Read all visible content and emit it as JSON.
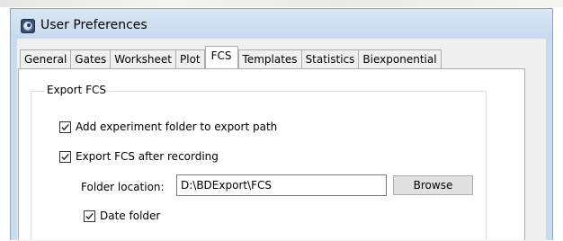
{
  "window": {
    "title": "User Preferences",
    "icon": "app-icon"
  },
  "tabs": [
    {
      "label": "General",
      "active": false
    },
    {
      "label": "Gates",
      "active": false
    },
    {
      "label": "Worksheet",
      "active": false
    },
    {
      "label": "Plot",
      "active": false
    },
    {
      "label": "FCS",
      "active": true
    },
    {
      "label": "Templates",
      "active": false
    },
    {
      "label": "Statistics",
      "active": false
    },
    {
      "label": "Biexponential",
      "active": false
    }
  ],
  "export_fcs": {
    "group_label": "Export FCS",
    "add_experiment_folder": {
      "label": "Add experiment folder to export path",
      "checked": true
    },
    "export_after_recording": {
      "label": "Export FCS after recording",
      "checked": true
    },
    "folder_location": {
      "label": "Folder location:",
      "value": "D:\\BDExport\\FCS"
    },
    "browse_label": "Browse",
    "date_folder": {
      "label": "Date folder",
      "checked": true
    }
  },
  "colors": {
    "titlebar": "#c9dcef",
    "panel": "#ffffff",
    "client": "#f0f0f0"
  }
}
